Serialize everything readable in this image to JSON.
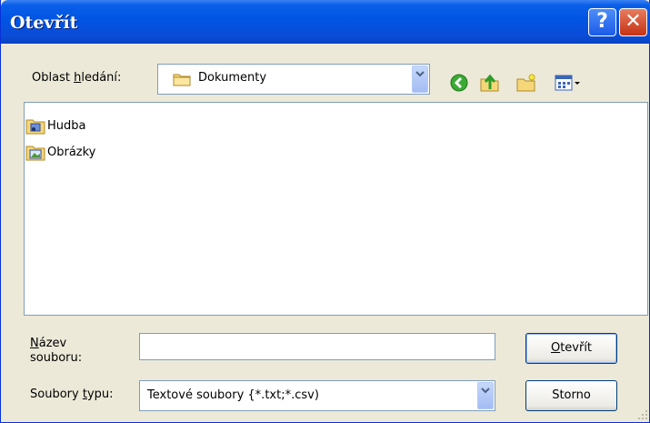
{
  "window": {
    "title": "Otevřít"
  },
  "lookin": {
    "label_pre": "Oblast ",
    "label_u": "h",
    "label_post": "ledání:",
    "value": "Dokumenty"
  },
  "files": [
    {
      "name": "Hudba"
    },
    {
      "name": "Obrázky"
    }
  ],
  "filename": {
    "label_u": "N",
    "label_line1_post": "ázev",
    "label_line2": "souboru:",
    "value": ""
  },
  "filetype": {
    "label_pre": "Soubory ",
    "label_u": "t",
    "label_post": "ypu:",
    "value": "Textové soubory {*.txt;*.csv)"
  },
  "buttons": {
    "open_u": "O",
    "open_post": "tevřít",
    "cancel": "Storno"
  },
  "titlebar_buttons": {
    "help": "?",
    "close": "✕"
  }
}
